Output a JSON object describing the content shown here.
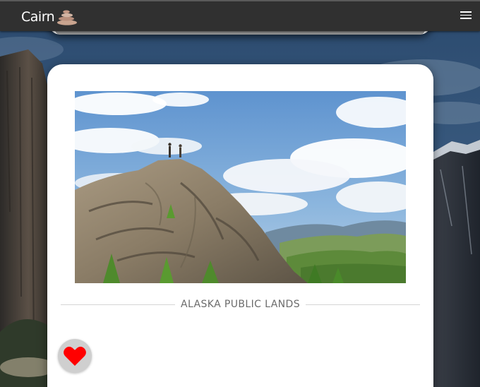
{
  "navbar": {
    "brand": "Cairn",
    "logo_icon": "cairn-stones-icon",
    "menu_icon": "hamburger-menu-icon"
  },
  "card": {
    "title": "ALASKA PUBLIC LANDS",
    "photo": "rocky-outcrop-hikers-photo",
    "favorite_icon": "heart-icon",
    "favorite_color": "#ff0000"
  },
  "colors": {
    "navbar": "#303030",
    "card": "#ffffff",
    "favorite_button": "#cfcfcf"
  }
}
